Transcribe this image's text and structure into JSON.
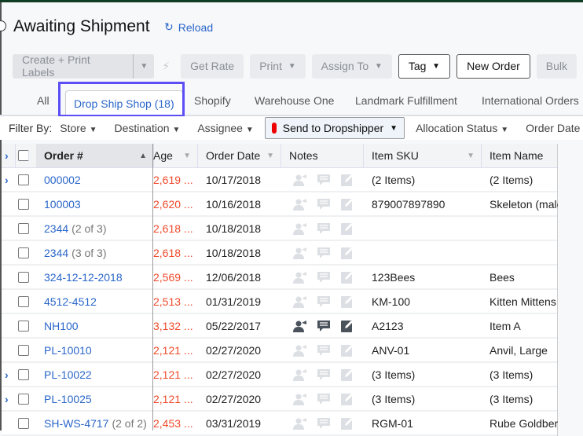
{
  "header": {
    "title": "Awaiting Shipment",
    "reload_label": "Reload"
  },
  "toolbar": {
    "create_print": "Create + Print Labels",
    "get_rate": "Get Rate",
    "print": "Print",
    "assign_to": "Assign To",
    "tag": "Tag",
    "new_order": "New Order",
    "bulk": "Bulk"
  },
  "tabs": [
    "All",
    "Drop Ship Shop (18)",
    "Shopify",
    "Warehouse One",
    "Landmark Fulfillment",
    "International Orders"
  ],
  "filters": {
    "label": "Filter By:",
    "items": [
      "Store",
      "Destination",
      "Assignee",
      "Send to Dropshipper",
      "Allocation Status",
      "Order Date"
    ],
    "active": "Send to Dropshipper"
  },
  "columns": {
    "order": "Order #",
    "age": "Age",
    "date": "Order Date",
    "notes": "Notes",
    "sku": "Item SKU",
    "name": "Item Name"
  },
  "colors": {
    "accent": "#2a66c9",
    "age": "#ef4a2b",
    "highlight": "#5b4ef5"
  },
  "rows": [
    {
      "expand": true,
      "order": "000002",
      "sub": "",
      "age": "2,619 ...",
      "date": "10/17/2018",
      "notes_active": false,
      "sku": "(2 Items)",
      "name": "(2 Items)"
    },
    {
      "expand": false,
      "order": "100003",
      "sub": "",
      "age": "2,620 ...",
      "date": "10/16/2018",
      "notes_active": false,
      "sku": "879007897890",
      "name": "Skeleton (male"
    },
    {
      "expand": false,
      "order": "2344",
      "sub": "(2 of 3)",
      "age": "2,618 ...",
      "date": "10/18/2018",
      "notes_active": false,
      "sku": "",
      "name": ""
    },
    {
      "expand": false,
      "order": "2344",
      "sub": "(3 of 3)",
      "age": "2,618 ...",
      "date": "10/18/2018",
      "notes_active": false,
      "sku": "",
      "name": ""
    },
    {
      "expand": false,
      "order": "324-12-12-2018",
      "sub": "",
      "age": "2,569 ...",
      "date": "12/06/2018",
      "notes_active": false,
      "sku": "123Bees",
      "name": "Bees"
    },
    {
      "expand": false,
      "order": "4512-4512",
      "sub": "",
      "age": "2,513 ...",
      "date": "01/31/2019",
      "notes_active": false,
      "sku": "KM-100",
      "name": "Kitten Mittens"
    },
    {
      "expand": false,
      "order": "NH100",
      "sub": "",
      "age": "3,132 ...",
      "date": "05/22/2017",
      "notes_active": true,
      "sku": "A2123",
      "name": "Item A"
    },
    {
      "expand": false,
      "order": "PL-10010",
      "sub": "",
      "age": "2,121 ...",
      "date": "02/27/2020",
      "notes_active": false,
      "sku": "ANV-01",
      "name": "Anvil, Large"
    },
    {
      "expand": true,
      "order": "PL-10022",
      "sub": "",
      "age": "2,121 ...",
      "date": "02/27/2020",
      "notes_active": false,
      "sku": "(3 Items)",
      "name": "(3 Items)"
    },
    {
      "expand": true,
      "order": "PL-10025",
      "sub": "",
      "age": "2,121 ...",
      "date": "02/27/2020",
      "notes_active": false,
      "sku": "(3 Items)",
      "name": "(3 Items)"
    },
    {
      "expand": false,
      "order": "SH-WS-4717",
      "sub": "(2 of 2)",
      "age": "2,453 ...",
      "date": "03/31/2019",
      "notes_active": false,
      "sku": "RGM-01",
      "name": "Rube Goldberg"
    }
  ]
}
